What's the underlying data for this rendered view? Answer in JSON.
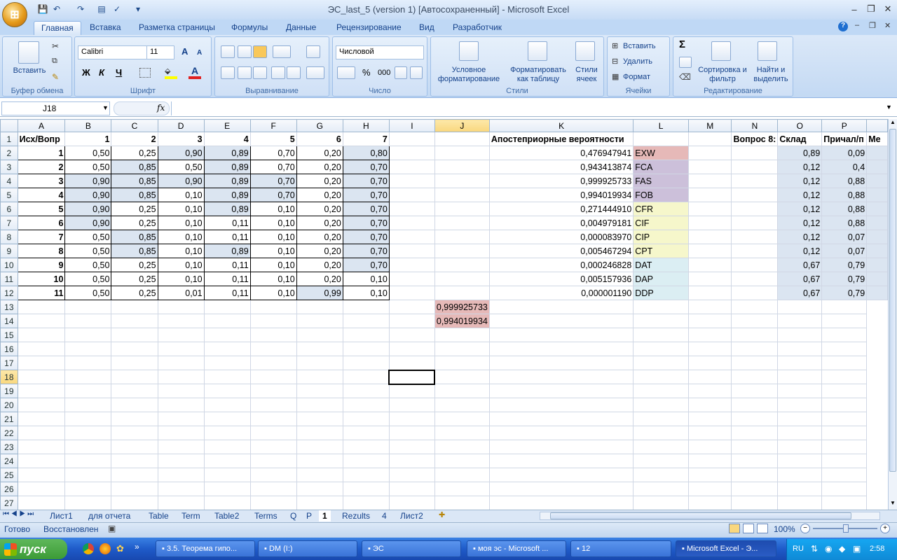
{
  "window": {
    "title": "ЭС_last_5 (version 1) [Автосохраненный] - Microsoft Excel"
  },
  "ribbon": {
    "tabs": [
      "Главная",
      "Вставка",
      "Разметка страницы",
      "Формулы",
      "Данные",
      "Рецензирование",
      "Вид",
      "Разработчик"
    ],
    "clipboard": {
      "paste": "Вставить",
      "label": "Буфер обмена"
    },
    "font": {
      "name": "Calibri",
      "size": "11",
      "label": "Шрифт",
      "bold": "Ж",
      "italic": "К",
      "underline": "Ч",
      "grow": "A",
      "shrink": "A"
    },
    "alignment": {
      "label": "Выравнивание"
    },
    "number": {
      "format": "Числовой",
      "label": "Число",
      "percent": "%",
      "thousands": "000"
    },
    "styles": {
      "conditional": "Условное форматирование",
      "table": "Форматировать как таблицу",
      "cell": "Стили ячеек",
      "label": "Стили"
    },
    "cells": {
      "insert": "Вставить",
      "delete": "Удалить",
      "format": "Формат",
      "label": "Ячейки"
    },
    "editing": {
      "sum": "Σ",
      "sort": "Сортировка и фильтр",
      "find": "Найти и выделить",
      "label": "Редактирование"
    }
  },
  "formula_bar": {
    "name_box": "J18",
    "fx": "fx",
    "value": ""
  },
  "columns": [
    "A",
    "B",
    "C",
    "D",
    "E",
    "F",
    "G",
    "H",
    "I",
    "J",
    "K",
    "L",
    "M",
    "N",
    "O",
    "P",
    ""
  ],
  "selected": {
    "column": "J",
    "row": "18"
  },
  "row_numbers": [
    "1",
    "2",
    "3",
    "4",
    "5",
    "6",
    "7",
    "8",
    "9",
    "10",
    "11",
    "12",
    "13",
    "14",
    "15",
    "16",
    "17",
    "18",
    "19",
    "20",
    "21",
    "22",
    "23",
    "24",
    "25",
    "26",
    "27"
  ],
  "cells": {
    "header": [
      "Исх/Вопр",
      "1",
      "2",
      "3",
      "4",
      "5",
      "6",
      "7"
    ],
    "k1": "Апостеприорные вероятности",
    "n1": "Вопрос 8:",
    "o1": "Склад",
    "p1": "Причал/п",
    "q1": "Ме",
    "rows": [
      {
        "a": "1",
        "v": [
          "0,50",
          "0,25",
          "0,90",
          "0,89",
          "0,70",
          "0,20",
          "0,80"
        ],
        "k": "0,476947941",
        "l": "EXW",
        "o": "0,89",
        "p": "0,09"
      },
      {
        "a": "2",
        "v": [
          "0,50",
          "0,85",
          "0,50",
          "0,89",
          "0,70",
          "0,20",
          "0,70"
        ],
        "k": "0,943413874",
        "l": "FCA",
        "o": "0,12",
        "p": "0,4"
      },
      {
        "a": "3",
        "v": [
          "0,90",
          "0,85",
          "0,90",
          "0,89",
          "0,70",
          "0,20",
          "0,70"
        ],
        "k": "0,999925733",
        "l": "FAS",
        "o": "0,12",
        "p": "0,88"
      },
      {
        "a": "4",
        "v": [
          "0,90",
          "0,85",
          "0,10",
          "0,89",
          "0,70",
          "0,20",
          "0,70"
        ],
        "k": "0,994019934",
        "l": "FOB",
        "o": "0,12",
        "p": "0,88"
      },
      {
        "a": "5",
        "v": [
          "0,90",
          "0,25",
          "0,10",
          "0,89",
          "0,10",
          "0,20",
          "0,70"
        ],
        "k": "0,271444910",
        "l": "CFR",
        "o": "0,12",
        "p": "0,88"
      },
      {
        "a": "6",
        "v": [
          "0,90",
          "0,25",
          "0,10",
          "0,11",
          "0,10",
          "0,20",
          "0,70"
        ],
        "k": "0,004979181",
        "l": "CIF",
        "o": "0,12",
        "p": "0,88"
      },
      {
        "a": "7",
        "v": [
          "0,50",
          "0,85",
          "0,10",
          "0,11",
          "0,10",
          "0,20",
          "0,70"
        ],
        "k": "0,000083970",
        "l": "CIP",
        "o": "0,12",
        "p": "0,07"
      },
      {
        "a": "8",
        "v": [
          "0,50",
          "0,85",
          "0,10",
          "0,89",
          "0,10",
          "0,20",
          "0,70"
        ],
        "k": "0,005467294",
        "l": "CPT",
        "o": "0,12",
        "p": "0,07"
      },
      {
        "a": "9",
        "v": [
          "0,50",
          "0,25",
          "0,10",
          "0,11",
          "0,10",
          "0,20",
          "0,70"
        ],
        "k": "0,000246828",
        "l": "DAT",
        "o": "0,67",
        "p": "0,79"
      },
      {
        "a": "10",
        "v": [
          "0,50",
          "0,25",
          "0,10",
          "0,11",
          "0,10",
          "0,20",
          "0,10"
        ],
        "k": "0,005157936",
        "l": "DAP",
        "o": "0,67",
        "p": "0,79"
      },
      {
        "a": "11",
        "v": [
          "0,50",
          "0,25",
          "0,01",
          "0,11",
          "0,10",
          "0,99",
          "0,10"
        ],
        "k": "0,000001190",
        "l": "DDP",
        "o": "0,67",
        "p": "0,79"
      }
    ],
    "k13": "0,999925733",
    "k14": "0,994019934"
  },
  "sheet_tabs": [
    "Лист1",
    "для отчета",
    "Table",
    "Term",
    "Table2",
    "Terms",
    "Q",
    "P",
    "1",
    "Rezults",
    "4",
    "Лист2"
  ],
  "active_sheet": "1",
  "status": {
    "ready": "Готово",
    "restored": "Восстановлен",
    "zoom": "100%"
  },
  "taskbar": {
    "start": "пуск",
    "tasks": [
      "3.5. Теорема гипо...",
      "DM (I:)",
      "ЭС",
      "моя эс - Microsoft ...",
      "12",
      "Microsoft Excel - Э..."
    ],
    "lang": "RU",
    "clock": "2:58"
  }
}
